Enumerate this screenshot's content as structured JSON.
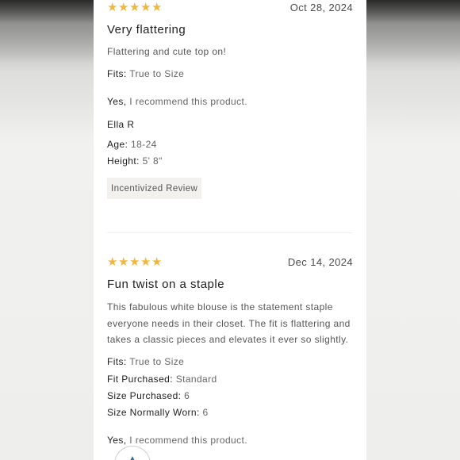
{
  "reviews": [
    {
      "rating_stars": 5,
      "date": "Oct 28, 2024",
      "title": "Very flattering",
      "body": "Flattering and cute top on!",
      "fits_key": "Fits:",
      "fits_val": "True to Size",
      "recommend_key": "Yes,",
      "recommend_val": "I recommend this product.",
      "reviewer": "Ella R",
      "age_key": "Age:",
      "age_val": "18-24",
      "height_key": "Height:",
      "height_val": "5' 8\"",
      "tag": "Incentivized Review"
    },
    {
      "rating_stars": 5,
      "date": "Dec 14, 2024",
      "title": "Fun twist on a staple",
      "body": "This fabulous white blouse is the statement staple everyone needs in their closet. The fit is flattering and takes a classic pieces and elevates it ever so slightly.",
      "fits_key": "Fits:",
      "fits_val": "True to Size",
      "fit_purchased_key": "Fit Purchased:",
      "fit_purchased_val": "Standard",
      "size_purchased_key": "Size Purchased:",
      "size_purchased_val": "6",
      "size_worn_key": "Size Normally Worn:",
      "size_worn_val": "6",
      "recommend_key": "Yes,",
      "recommend_val": "I recommend this product."
    }
  ],
  "icons": {
    "star": "star-icon"
  },
  "colors": {
    "star": "#f0b73a",
    "tag_bg": "#f3f1ee"
  }
}
